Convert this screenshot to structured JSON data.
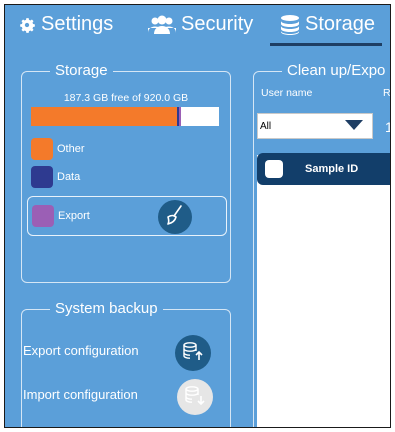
{
  "tabs": [
    {
      "label": "Settings",
      "icon": "gear-icon"
    },
    {
      "label": "Security",
      "icon": "users-icon"
    },
    {
      "label": "Storage",
      "icon": "database-icon"
    }
  ],
  "active_tab": "Storage",
  "storage": {
    "legend": "Storage",
    "free_text": "187.3 GB free of 920.0 GB",
    "usage": {
      "other_fraction": 0.775,
      "data_fraction": 0.01,
      "export_fraction": 0.012
    },
    "legend_items": [
      {
        "label": "Other",
        "color": "#f47a2a"
      },
      {
        "label": "Data",
        "color": "#2e3a90"
      },
      {
        "label": "Export",
        "color": "#9b5fb5"
      }
    ],
    "clean_icon": "broom-icon"
  },
  "backup": {
    "legend": "System backup",
    "export_label": "Export configuration",
    "import_label": "Import configuration"
  },
  "cleanup": {
    "legend": "Clean up/Expo",
    "username_header": "User name",
    "r_header": "R",
    "user_select_value": "All",
    "one_value": "1",
    "table_header": "Sample ID"
  },
  "colors": {
    "background": "#5b9fd9",
    "dark_blue": "#123e6a",
    "button_blue": "#1f5c88"
  }
}
